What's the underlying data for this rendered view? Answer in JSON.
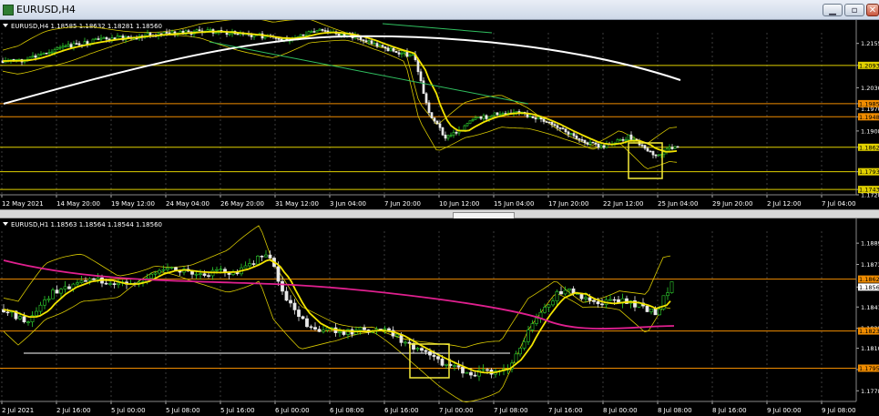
{
  "window": {
    "title": "EURUSD,H4"
  },
  "colors": {
    "background": "#000000",
    "grid": "#3c3c3c",
    "bull": "#2fd12f",
    "bear": "#e9e9e9",
    "ma_slow": "#ffffff",
    "ma_fast": "#f2e400",
    "bands": "#d7c800",
    "wma": "#e0208f",
    "level_orange": "#f08c00",
    "level_yellow": "#e0d000",
    "trendline": "#30c060"
  },
  "panes": [
    {
      "id": "h4",
      "header": "EURUSD,H4  1.18585 1.18632 1.18281 1.18560",
      "y_ticks": [
        "1.2155",
        "1.2093",
        "1.2030",
        "1.1985",
        "1.1970",
        "1.1948",
        "1.1908",
        "1.1862",
        "1.1793",
        "1.1743",
        "1.1728"
      ],
      "price_tags": [
        {
          "label": "1.2093",
          "kind": "yellow",
          "value": 1.2093
        },
        {
          "label": "1.1985",
          "kind": "orange",
          "value": 1.1985
        },
        {
          "label": "1.1948",
          "kind": "orange",
          "value": 1.1948
        },
        {
          "label": "1.1862",
          "kind": "yellow",
          "value": 1.1862
        },
        {
          "label": "1.1793",
          "kind": "yellow",
          "value": 1.1793
        },
        {
          "label": "1.1743",
          "kind": "yellow",
          "value": 1.1743
        }
      ],
      "x_labels": [
        "12 May 2021",
        "14 May 20:00",
        "19 May 12:00",
        "24 May 04:00",
        "26 May 20:00",
        "31 May 12:00",
        "3 Jun 04:00",
        "7 Jun 20:00",
        "10 Jun 12:00",
        "15 Jun 04:00",
        "17 Jun 20:00",
        "22 Jun 12:00",
        "25 Jun 04:00",
        "29 Jun 20:00",
        "2 Jul 12:00",
        "7 Jul 04:00"
      ],
      "y_range": [
        1.1728,
        1.2185
      ]
    },
    {
      "id": "h1",
      "header": "EURUSD,H1  1.18563 1.18564 1.18544 1.18560",
      "y_ticks": [
        "1.1889",
        "1.1873",
        "1.1856",
        "1.1841",
        "1.1825",
        "1.1810",
        "1.1794",
        "1.1778"
      ],
      "price_tags": [
        {
          "label": "1.1862",
          "kind": "orange",
          "value": 1.1862
        },
        {
          "label": "1.1856",
          "kind": "white",
          "value": 1.1856
        },
        {
          "label": "1.1823",
          "kind": "orange",
          "value": 1.1823
        },
        {
          "label": "1.1795",
          "kind": "orange",
          "value": 1.1795
        }
      ],
      "x_labels": [
        "2 Jul 2021",
        "2 Jul 16:00",
        "5 Jul 00:00",
        "5 Jul 08:00",
        "5 Jul 16:00",
        "6 Jul 00:00",
        "6 Jul 08:00",
        "6 Jul 16:00",
        "7 Jul 00:00",
        "7 Jul 08:00",
        "7 Jul 16:00",
        "8 Jul 00:00",
        "8 Jul 08:00",
        "8 Jul 16:00",
        "9 Jul 00:00",
        "9 Jul 08:00"
      ],
      "y_range": [
        1.177,
        1.1898
      ]
    }
  ]
}
